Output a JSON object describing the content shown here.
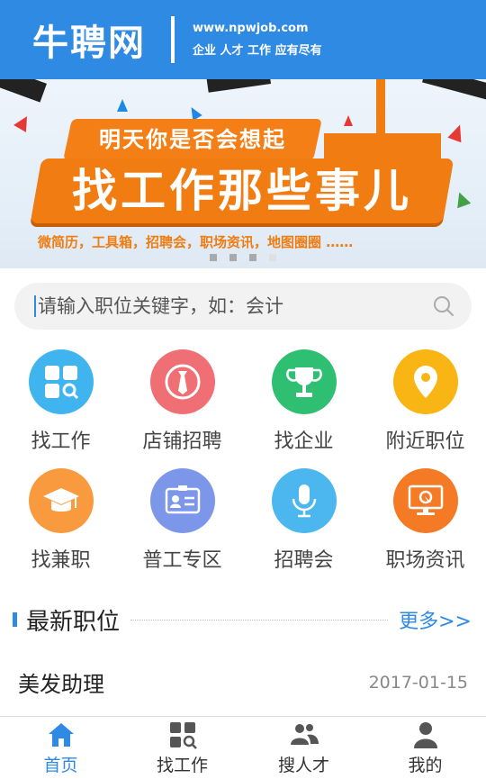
{
  "header": {
    "logo": "牛聘网",
    "url": "www.npwjob.com",
    "tagline": "企业 人才 工作 应有尽有"
  },
  "banner": {
    "subtitle": "明天你是否会想起",
    "title": "找工作那些事儿",
    "description": "微简历，工具箱，招聘会，职场资讯，地图圈圈 ……",
    "slides": 4,
    "active_slide": 4
  },
  "search": {
    "placeholder": "请输入职位关键字，如：会计",
    "icon": "search-icon"
  },
  "grid": [
    {
      "label": "找工作",
      "icon": "grid-search-icon",
      "color": "#3fb4ee"
    },
    {
      "label": "店铺招聘",
      "icon": "tie-icon",
      "color": "#f06f74"
    },
    {
      "label": "找企业",
      "icon": "trophy-icon",
      "color": "#2fbf73"
    },
    {
      "label": "附近职位",
      "icon": "location-pin-icon",
      "color": "#f9b514"
    },
    {
      "label": "找兼职",
      "icon": "graduation-cap-icon",
      "color": "#f99a3e"
    },
    {
      "label": "普工专区",
      "icon": "id-card-icon",
      "color": "#7c97ea"
    },
    {
      "label": "招聘会",
      "icon": "microphone-icon",
      "color": "#4cb7ee"
    },
    {
      "label": "职场资讯",
      "icon": "monitor-icon",
      "color": "#f57a26"
    }
  ],
  "latest": {
    "title": "最新职位",
    "more": "更多>>",
    "jobs": [
      {
        "title": "美发助理",
        "date": "2017-01-15"
      }
    ]
  },
  "tabbar": [
    {
      "label": "首页",
      "icon": "home-icon",
      "active": true
    },
    {
      "label": "找工作",
      "icon": "find-job-icon",
      "active": false
    },
    {
      "label": "搜人才",
      "icon": "people-icon",
      "active": false
    },
    {
      "label": "我的",
      "icon": "user-icon",
      "active": false
    }
  ],
  "colors": {
    "brand": "#2f8ae3",
    "banner_orange": "#f07c12"
  }
}
